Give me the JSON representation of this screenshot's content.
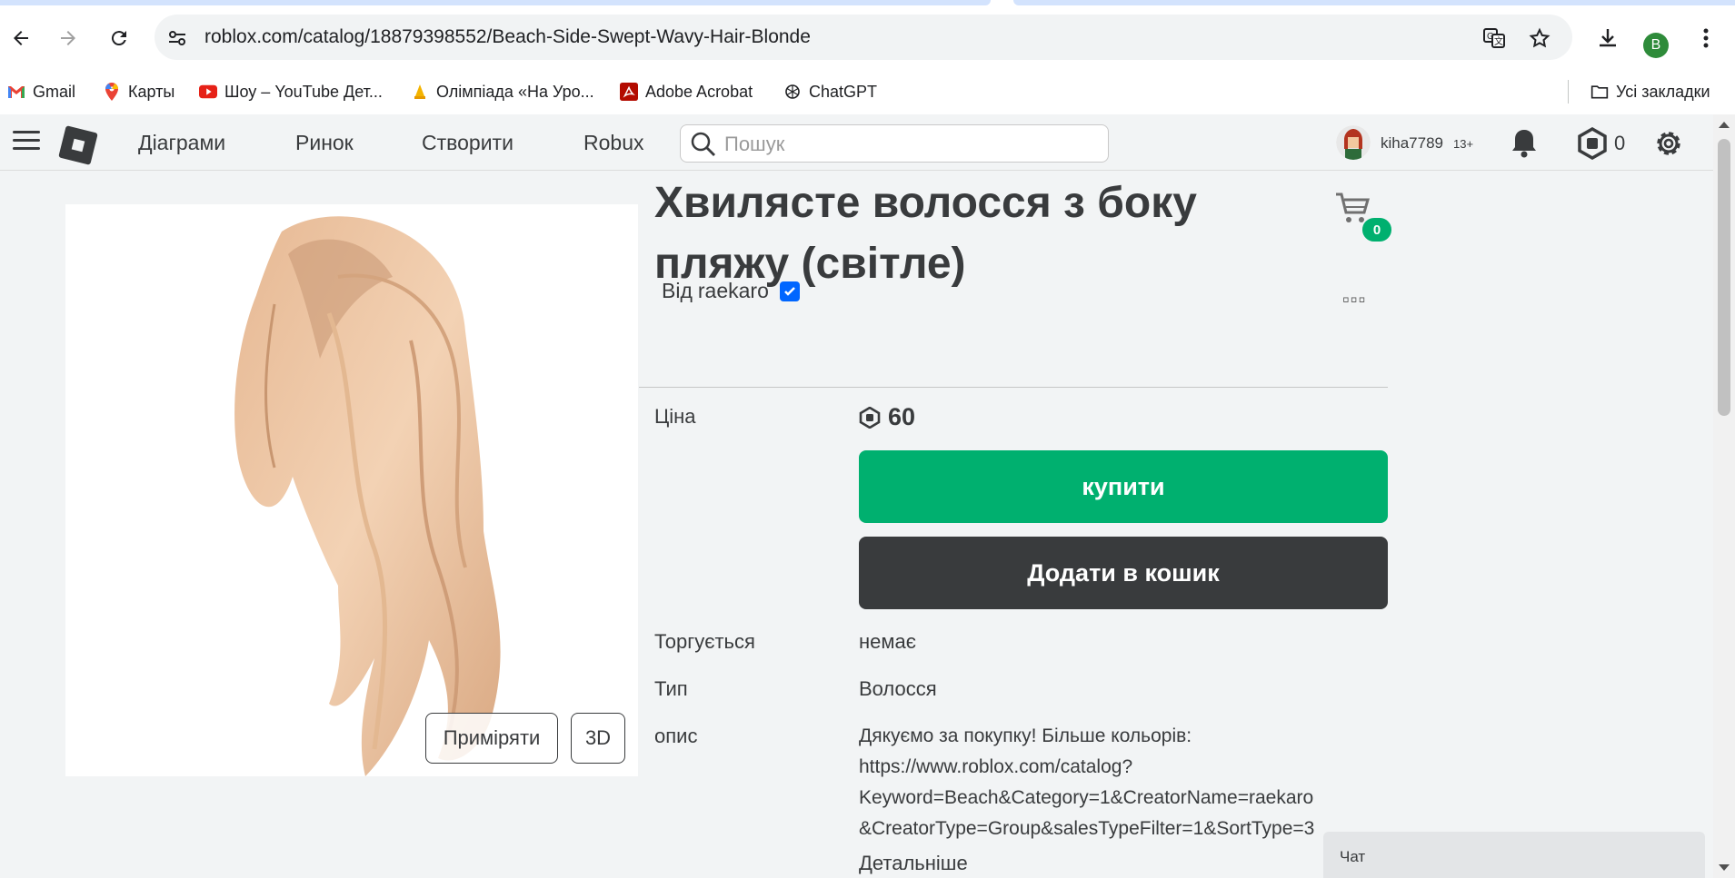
{
  "browser": {
    "url": "roblox.com/catalog/18879398552/Beach-Side-Swept-Wavy-Hair-Blonde",
    "profile_initial": "B",
    "bookmarks": [
      {
        "label": "Gmail",
        "icon": "gmail-icon"
      },
      {
        "label": "Карты",
        "icon": "maps-icon"
      },
      {
        "label": "Шоу – YouTube Дет...",
        "icon": "youtube-icon"
      },
      {
        "label": "Олімпіада «На Уро...",
        "icon": "olympiad-icon"
      },
      {
        "label": "Adobe Acrobat",
        "icon": "acrobat-icon"
      },
      {
        "label": "ChatGPT",
        "icon": "chatgpt-icon"
      }
    ],
    "all_bookmarks_label": "Усі закладки"
  },
  "header": {
    "nav": [
      "Діаграми",
      "Ринок",
      "Створити",
      "Robux"
    ],
    "search_placeholder": "Пошук",
    "username": "kiha7789",
    "age_badge": "13+",
    "robux_balance": "0"
  },
  "item": {
    "title": "Хвилясте волосся з боку пляжу (світле)",
    "by_label": "Від",
    "creator": "raekaro",
    "cart_count": "0",
    "more_menu": "▫▫▫",
    "try_on_label": "Приміряти",
    "three_d_label": "3D",
    "price_label": "Ціна",
    "price_value": "60",
    "buy_label": "купити",
    "add_to_cart_label": "Додати в кошик",
    "tradable_label": "Торгується",
    "tradable_value": "немає",
    "type_label": "Тип",
    "type_value": "Волосся",
    "description_label": "опис",
    "description_lines": [
      "Дякуємо за покупку! Більше кольорів:",
      "https://www.roblox.com/catalog?",
      "Keyword=Beach&Category=1&CreatorName=raekaro",
      "&CreatorType=Group&salesTypeFilter=1&SortType=3"
    ],
    "more_details_label": "Детальніше"
  },
  "chat": {
    "label": "Чат"
  },
  "colors": {
    "buy_green": "#00b06f",
    "dark_button": "#393b3d",
    "page_bg": "#f2f4f5",
    "verified_blue": "#0066ff"
  }
}
